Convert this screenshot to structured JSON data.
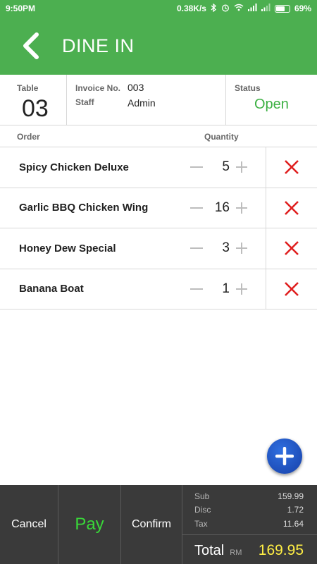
{
  "status_bar": {
    "time": "9:50PM",
    "net_speed": "0.38K/s",
    "battery_percent": "69%",
    "battery_level": 0.69,
    "icons": [
      "bluetooth-icon",
      "alarm-icon",
      "wifi-icon",
      "signal-icon",
      "signal-icon",
      "battery-icon"
    ]
  },
  "app_bar": {
    "title": "DINE IN",
    "back_icon": "chevron-left-icon"
  },
  "info": {
    "table_label": "Table",
    "table_value": "03",
    "invoice_label": "Invoice No.",
    "invoice_value": "003",
    "staff_label": "Staff",
    "staff_value": "Admin",
    "status_label": "Status",
    "status_value": "Open",
    "status_color": "#3cb043"
  },
  "columns": {
    "order": "Order",
    "quantity": "Quantity"
  },
  "orders": [
    {
      "name": "Spicy Chicken Deluxe",
      "qty": "5"
    },
    {
      "name": "Garlic BBQ Chicken Wing",
      "qty": "16"
    },
    {
      "name": "Honey Dew Special",
      "qty": "3"
    },
    {
      "name": "Banana Boat",
      "qty": "1"
    }
  ],
  "bottom": {
    "cancel": "Cancel",
    "pay": "Pay",
    "confirm": "Confirm",
    "sub_label": "Sub",
    "sub_value": "159.99",
    "disc_label": "Disc",
    "disc_value": "1.72",
    "tax_label": "Tax",
    "tax_value": "11.64",
    "total_label": "Total",
    "currency": "RM",
    "total_value": "169.95"
  },
  "colors": {
    "accent": "#4caf50",
    "delete": "#e02020",
    "pay": "#39d839",
    "total": "#ffee44",
    "fab": "#1f55c8"
  }
}
